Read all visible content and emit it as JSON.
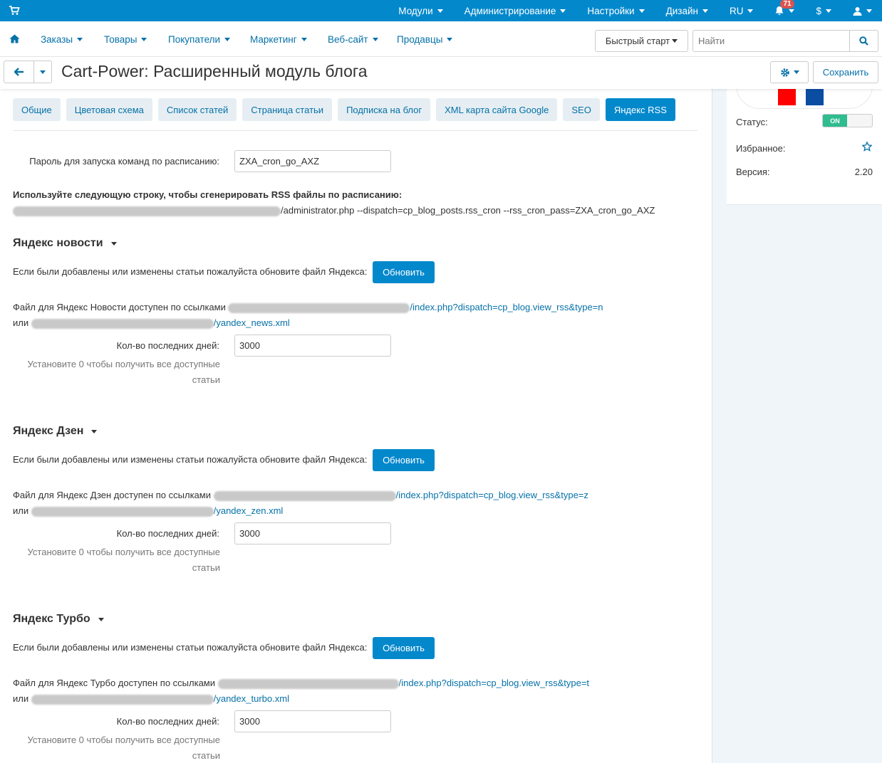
{
  "topbar": {
    "menus": [
      {
        "label": "Модули",
        "caret": true
      },
      {
        "label": "Администрирование",
        "caret": true
      },
      {
        "label": "Настройки",
        "caret": true
      },
      {
        "label": "Дизайн",
        "caret": true
      },
      {
        "label": "RU",
        "caret": true
      }
    ],
    "notifications_count": "71",
    "currency_label": "$"
  },
  "mainnav": {
    "items": [
      "Заказы",
      "Товары",
      "Покупатели",
      "Маркетинг",
      "Веб-сайт",
      "Продавцы"
    ],
    "quick_start_label": "Быстрый старт",
    "search_placeholder": "Найти"
  },
  "titlebar": {
    "title": "Cart-Power: Расширенный модуль блога",
    "save_label": "Сохранить"
  },
  "sidebar": {
    "status_label": "Статус:",
    "status_value": "ON",
    "favorite_label": "Избранное:",
    "version_label": "Версия:",
    "version_value": "2.20",
    "logo_colors": [
      "#ff0000",
      "#0b4da2"
    ]
  },
  "tabs": [
    {
      "label": "Общие",
      "active": false
    },
    {
      "label": "Цветовая схема",
      "active": false
    },
    {
      "label": "Список статей",
      "active": false
    },
    {
      "label": "Страница статьи",
      "active": false
    },
    {
      "label": "Подписка на блог",
      "active": false
    },
    {
      "label": "XML карта сайта Google",
      "active": false
    },
    {
      "label": "SEO",
      "active": false
    },
    {
      "label": "Яндекс RSS",
      "active": true
    }
  ],
  "cron": {
    "password_label": "Пароль для запуска команд по расписанию:",
    "password_value": "ZXA_cron_go_AXZ",
    "instruction": "Используйте следующую строку, чтобы сгенерировать RSS файлы по расписанию:",
    "command_tail": "/administrator.php --dispatch=cp_blog_posts.rss_cron --rss_cron_pass=ZXA_cron_go_AXZ"
  },
  "sections": [
    {
      "title": "Яндекс новости",
      "update_text": "Если были добавлены или изменены статьи пожалуйста обновите файл Яндекса:",
      "update_button": "Обновить",
      "file_text": "Файл для Яндекс Новости доступен по ссылками",
      "link1_tail": "/index.php?dispatch=cp_blog.view_rss&type=n",
      "or_text": "или",
      "link2_tail": "/yandex_news.xml",
      "days_label": "Кол-во последних дней:",
      "days_value": "3000",
      "hint": "Установите 0 чтобы получить все доступные статьи"
    },
    {
      "title": "Яндекс Дзен",
      "update_text": "Если были добавлены или изменены статьи пожалуйста обновите файл Яндекса:",
      "update_button": "Обновить",
      "file_text": "Файл для Яндекс Дзен доступен по ссылками",
      "link1_tail": "/index.php?dispatch=cp_blog.view_rss&type=z",
      "or_text": "или",
      "link2_tail": "/yandex_zen.xml",
      "days_label": "Кол-во последних дней:",
      "days_value": "3000",
      "hint": "Установите 0 чтобы получить все доступные статьи"
    },
    {
      "title": "Яндекс Турбо",
      "update_text": "Если были добавлены или изменены статьи пожалуйста обновите файл Яндекса:",
      "update_button": "Обновить",
      "file_text": "Файл для Яндекс Турбо доступен по ссылками",
      "link1_tail": "/index.php?dispatch=cp_blog.view_rss&type=t",
      "or_text": "или",
      "link2_tail": "/yandex_turbo.xml",
      "days_label": "Кол-во последних дней:",
      "days_value": "3000",
      "hint": "Установите 0 чтобы получить все доступные статьи"
    }
  ]
}
